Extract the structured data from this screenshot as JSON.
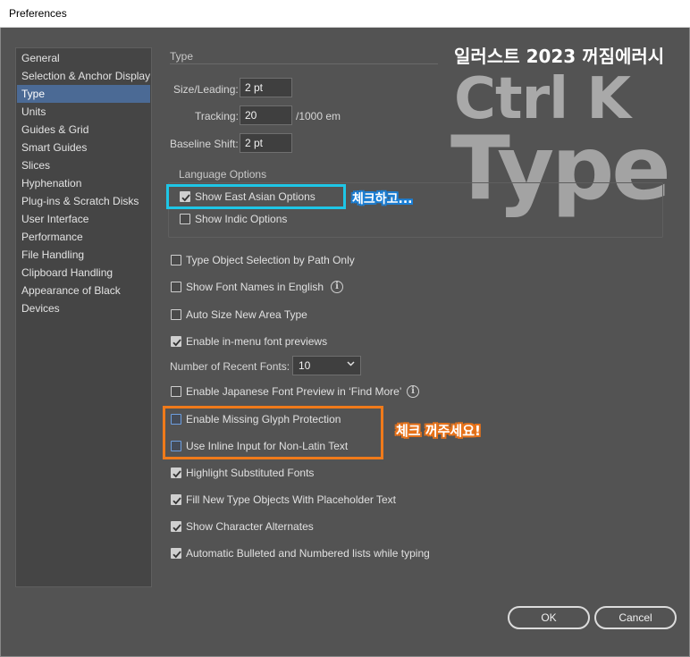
{
  "window": {
    "title": "Preferences"
  },
  "sidebar": {
    "items": [
      {
        "label": "General",
        "selected": false
      },
      {
        "label": "Selection & Anchor Display",
        "selected": false
      },
      {
        "label": "Type",
        "selected": true
      },
      {
        "label": "Units",
        "selected": false
      },
      {
        "label": "Guides & Grid",
        "selected": false
      },
      {
        "label": "Smart Guides",
        "selected": false
      },
      {
        "label": "Slices",
        "selected": false
      },
      {
        "label": "Hyphenation",
        "selected": false
      },
      {
        "label": "Plug-ins & Scratch Disks",
        "selected": false
      },
      {
        "label": "User Interface",
        "selected": false
      },
      {
        "label": "Performance",
        "selected": false
      },
      {
        "label": "File Handling",
        "selected": false
      },
      {
        "label": "Clipboard Handling",
        "selected": false
      },
      {
        "label": "Appearance of Black",
        "selected": false
      },
      {
        "label": "Devices",
        "selected": false
      }
    ]
  },
  "type_section": {
    "title": "Type",
    "size_leading": {
      "label": "Size/Leading:",
      "value": "2 pt"
    },
    "tracking": {
      "label": "Tracking:",
      "value": "20",
      "unit": "/1000 em"
    },
    "baseline_shift": {
      "label": "Baseline Shift:",
      "value": "2 pt"
    }
  },
  "language_options": {
    "title": "Language Options",
    "show_east_asian": {
      "label": "Show East Asian Options",
      "checked": true
    },
    "show_indic": {
      "label": "Show Indic Options",
      "checked": false
    }
  },
  "options": {
    "type_object_selection": {
      "label": "Type Object Selection by Path Only",
      "checked": false
    },
    "show_font_names_english": {
      "label": "Show Font Names in English",
      "checked": false
    },
    "auto_size_area_type": {
      "label": "Auto Size New Area Type",
      "checked": false
    },
    "enable_font_previews": {
      "label": "Enable in-menu font previews",
      "checked": true
    },
    "recent_fonts": {
      "label": "Number of Recent Fonts:",
      "value": "10"
    },
    "japanese_font_preview": {
      "label": "Enable Japanese Font Preview in ‘Find More’",
      "checked": false
    },
    "missing_glyph": {
      "label": "Enable Missing Glyph Protection",
      "checked": false
    },
    "inline_input": {
      "label": "Use Inline Input for Non-Latin Text",
      "checked": false
    },
    "highlight_substituted": {
      "label": "Highlight Substituted Fonts",
      "checked": true
    },
    "fill_placeholder": {
      "label": "Fill New Type Objects With Placeholder Text",
      "checked": true
    },
    "show_char_alternates": {
      "label": "Show Character Alternates",
      "checked": true
    },
    "auto_bullets": {
      "label": "Automatic Bulleted and Numbered lists while typing",
      "checked": true
    }
  },
  "buttons": {
    "ok": "OK",
    "cancel": "Cancel"
  },
  "overlay": {
    "header": "일러스트 2023 꺼짐에러시",
    "big_line1": "Ctrl K",
    "big_line2": "Type",
    "note_check": "체크하고...",
    "note_uncheck": "체크 꺼주세요!"
  },
  "colors": {
    "selected_bg": "#4b6a95",
    "highlight_cyan": "#1ec6e6",
    "highlight_orange": "#f07a1a"
  },
  "icons": [
    "info-icon",
    "check-icon",
    "chevron-down-icon"
  ]
}
